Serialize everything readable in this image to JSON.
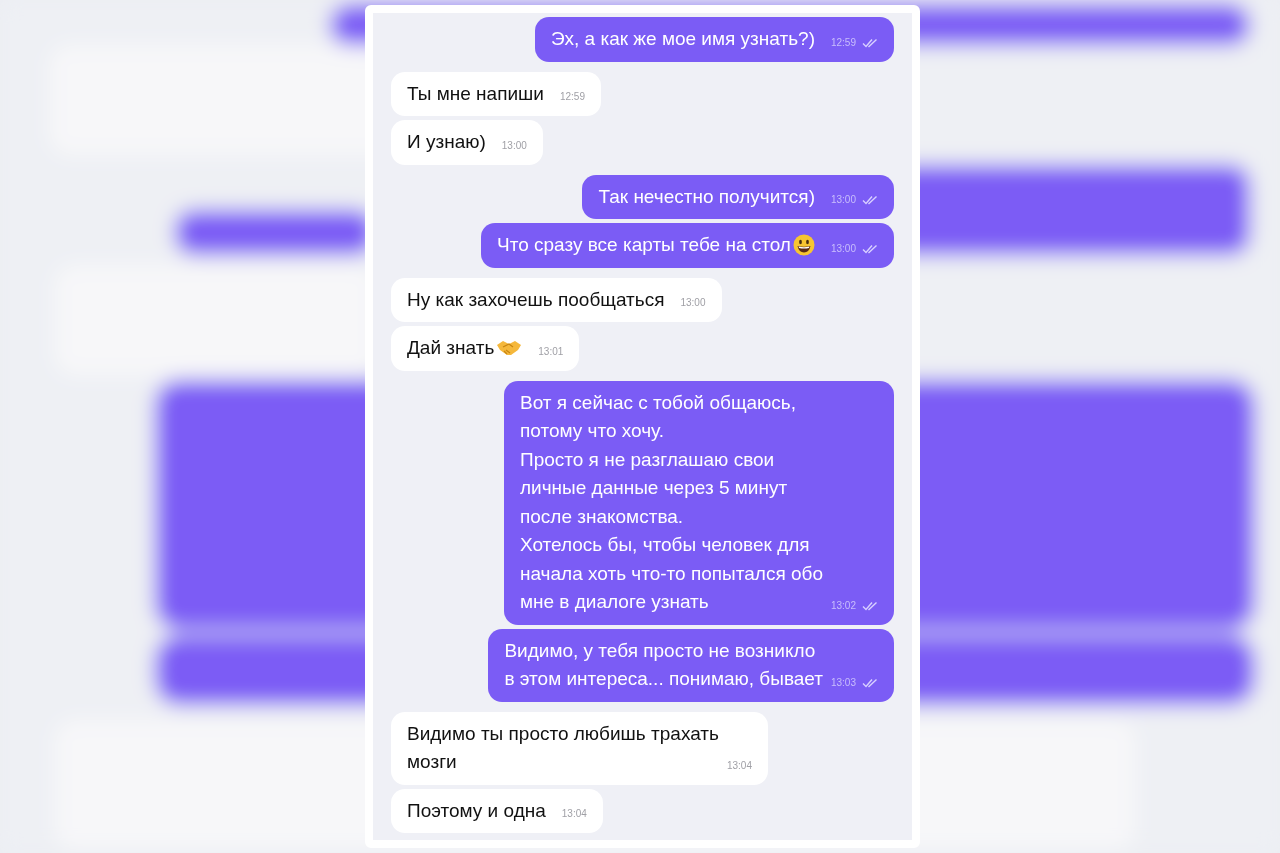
{
  "messages": [
    {
      "kind": "outgoing",
      "text": "Эх, а как же мое имя узнать?)",
      "time": "12:59",
      "read": true
    },
    {
      "kind": "incoming",
      "text": "Ты мне напиши",
      "time": "12:59"
    },
    {
      "kind": "incoming",
      "text": "И узнаю)",
      "time": "13:00"
    },
    {
      "kind": "outgoing",
      "text": "Так нечестно получится)",
      "time": "13:00",
      "read": true
    },
    {
      "kind": "outgoing",
      "text": "Что сразу все карты тебе на стол",
      "time": "13:00",
      "read": true
    },
    {
      "kind": "incoming",
      "text": "Ну как захочешь пообщаться",
      "time": "13:00"
    },
    {
      "kind": "incoming",
      "text": "Дай знать",
      "time": "13:01"
    },
    {
      "kind": "outgoing",
      "text": "Вот я сейчас с тобой общаюсь,\nпотому что хочу.\nПросто я не разглашаю свои\nличные данные через 5 минут\nпосле знакомства.\nХотелось бы, чтобы человек для\nначала хоть что-то попытался обо\nмне в диалоге узнать",
      "time": "13:02",
      "read": true
    },
    {
      "kind": "outgoing",
      "text": "Видимо, у тебя просто не возникло\nв этом интереса... понимаю, бывает",
      "time": "13:03",
      "read": true
    },
    {
      "kind": "incoming",
      "text": "Видимо ты просто любишь трахать\nмозги",
      "time": "13:04"
    },
    {
      "kind": "incoming",
      "text": "Поэтому и одна",
      "time": "13:04"
    }
  ]
}
